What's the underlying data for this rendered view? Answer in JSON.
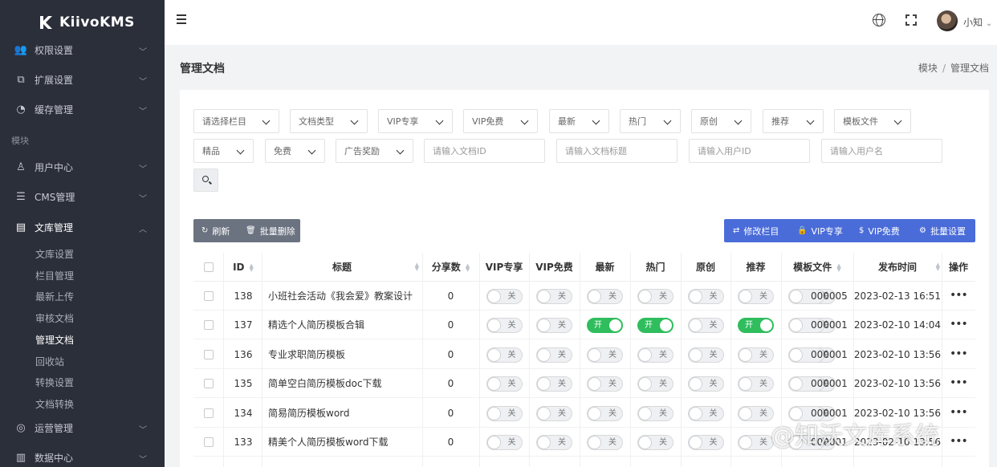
{
  "brand": {
    "name": "KiivoKMS"
  },
  "sidebar": {
    "items": [
      {
        "label": "权限设置",
        "icon": "users-icon"
      },
      {
        "label": "扩展设置",
        "icon": "puzzle-icon"
      },
      {
        "label": "缓存管理",
        "icon": "gauge-icon"
      }
    ],
    "section_label": "模块",
    "module_items": [
      {
        "label": "用户中心",
        "icon": "user-icon"
      },
      {
        "label": "CMS管理",
        "icon": "list-icon"
      },
      {
        "label": "文库管理",
        "icon": "document-icon"
      }
    ],
    "sub_items": [
      "文库设置",
      "栏目管理",
      "最新上传",
      "审核文档",
      "管理文档",
      "回收站",
      "转换设置",
      "文档转换"
    ],
    "bottom_items": [
      {
        "label": "运营管理",
        "icon": "globe-icon"
      },
      {
        "label": "数据中心",
        "icon": "chart-icon"
      }
    ]
  },
  "header": {
    "username": "小知",
    "user_chevron": "⌄"
  },
  "page": {
    "title": "管理文档",
    "breadcrumb": [
      "模块",
      "管理文档"
    ],
    "breadcrumb_sep": "/"
  },
  "filters": {
    "selects_row1": [
      "请选择栏目",
      "文档类型",
      "VIP专享",
      "VIP免费",
      "最新",
      "热门",
      "原创",
      "推荐",
      "模板文件"
    ],
    "selects_row2": [
      "精品",
      "免费",
      "广告奖励"
    ],
    "inputs": [
      "请输入文档ID",
      "请输入文档标题",
      "请输入用户ID",
      "请输入用户名"
    ]
  },
  "toolbar": {
    "refresh": "刷新",
    "batch_delete": "批量删除",
    "modify_column": "修改栏目",
    "vip_exclusive": "VIP专享",
    "vip_free": "VIP免费",
    "batch_settings": "批量设置"
  },
  "table": {
    "headers": [
      "ID",
      "标题",
      "分享数",
      "VIP专享",
      "VIP免费",
      "最新",
      "热门",
      "原创",
      "推荐",
      "模板文件",
      "发布时间",
      "操作"
    ],
    "switch_on_label": "开",
    "switch_off_label": "关",
    "rows": [
      {
        "id": "138",
        "title": "小班社会活动《我会爱》教案设计",
        "shares": "0",
        "tpl": "000005",
        "time": "2023-02-13 16:51",
        "sw": [
          0,
          0,
          0,
          0,
          0,
          0,
          0
        ]
      },
      {
        "id": "137",
        "title": "精选个人简历模板合辑",
        "shares": "0",
        "tpl": "000001",
        "time": "2023-02-10 14:04",
        "sw": [
          0,
          0,
          1,
          1,
          0,
          1,
          0
        ]
      },
      {
        "id": "136",
        "title": "专业求职简历模板",
        "shares": "0",
        "tpl": "000001",
        "time": "2023-02-10 13:56",
        "sw": [
          0,
          0,
          0,
          0,
          0,
          0,
          0
        ]
      },
      {
        "id": "135",
        "title": "简单空白简历模板doc下载",
        "shares": "0",
        "tpl": "000001",
        "time": "2023-02-10 13:56",
        "sw": [
          0,
          0,
          0,
          0,
          0,
          0,
          0
        ]
      },
      {
        "id": "134",
        "title": "简易简历模板word",
        "shares": "0",
        "tpl": "000001",
        "time": "2023-02-10 13:56",
        "sw": [
          0,
          0,
          0,
          0,
          0,
          0,
          0
        ]
      },
      {
        "id": "133",
        "title": "精美个人简历模板word下载",
        "shares": "0",
        "tpl": "000001",
        "time": "2023-02-10 13:56",
        "sw": [
          0,
          0,
          0,
          0,
          0,
          0,
          0
        ]
      }
    ],
    "more_label": "•••"
  },
  "watermark": "@知沃文库系统"
}
